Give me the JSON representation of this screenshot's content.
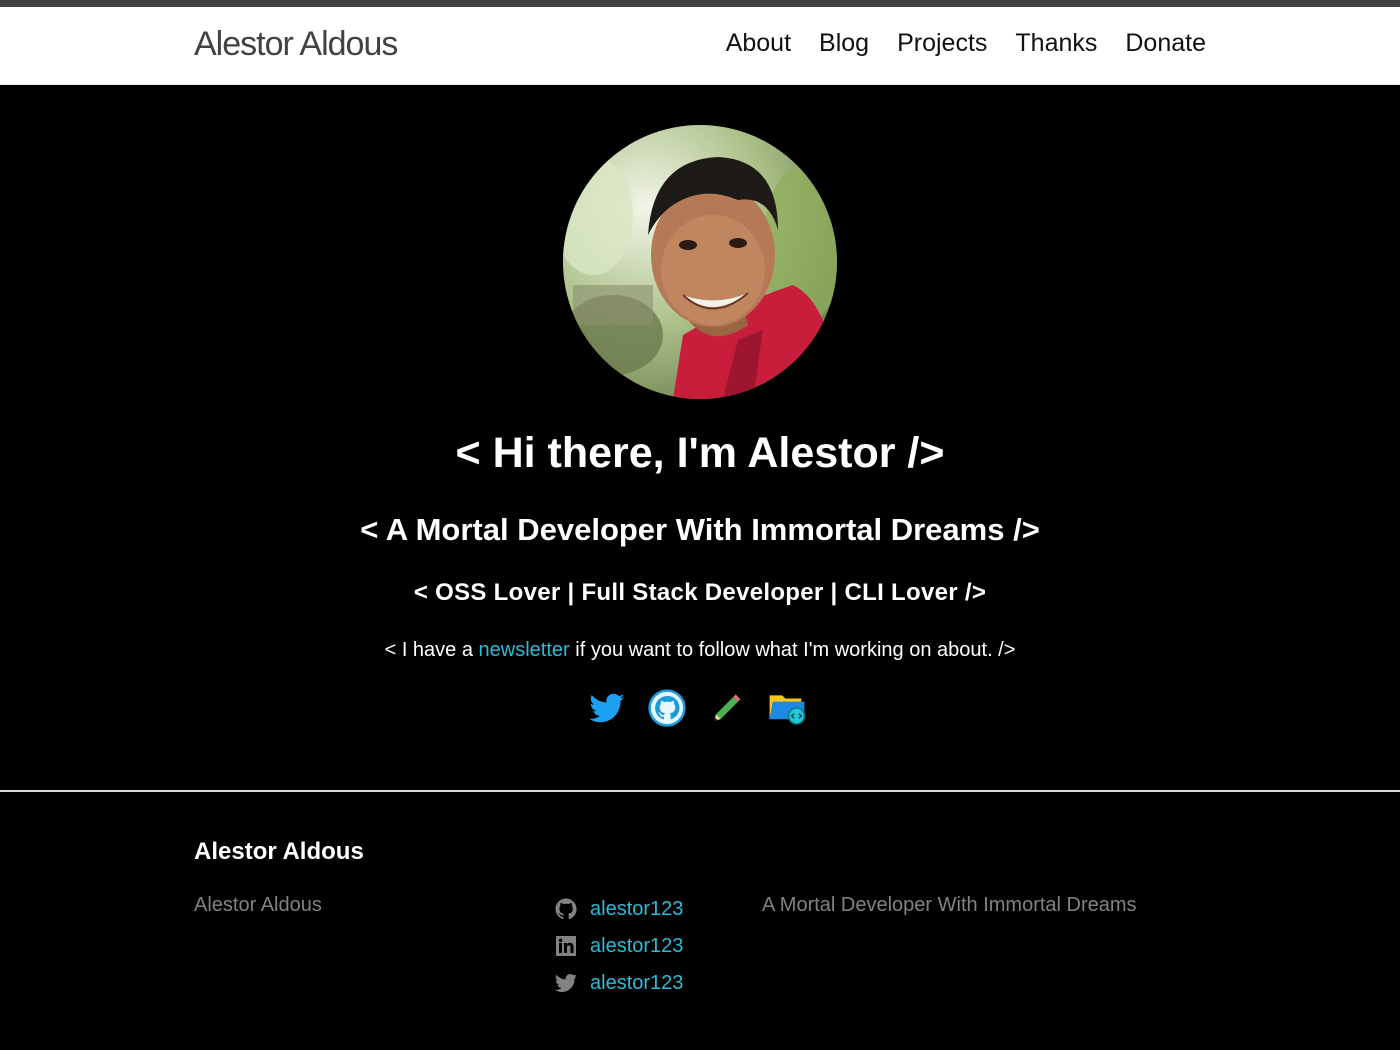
{
  "header": {
    "site_title": "Alestor Aldous",
    "nav": [
      {
        "label": "About"
      },
      {
        "label": "Blog"
      },
      {
        "label": "Projects"
      },
      {
        "label": "Thanks"
      },
      {
        "label": "Donate"
      }
    ]
  },
  "hero": {
    "title": "< Hi there, I'm Alestor />",
    "subtitle": "< A Mortal Developer With Immortal Dreams />",
    "tagline": "< OSS Lover | Full Stack Developer | CLI Lover />",
    "newsletter_prefix": "< I have a ",
    "newsletter_link": "newsletter",
    "newsletter_suffix": " if you want to follow what I'm working on about. />",
    "social_icons": [
      "twitter-icon",
      "github-icon",
      "pencil-icon",
      "folder-code-icon"
    ]
  },
  "footer": {
    "heading": "Alestor Aldous",
    "name": "Alestor Aldous",
    "links": [
      {
        "icon": "github-icon",
        "label": "alestor123"
      },
      {
        "icon": "linkedin-icon",
        "label": "alestor123"
      },
      {
        "icon": "twitter-icon",
        "label": "alestor123"
      }
    ],
    "description": "A Mortal Developer With Immortal Dreams"
  },
  "colors": {
    "accent": "#2bbbd8",
    "background": "#000000",
    "header_bg": "#ffffff",
    "muted_text": "#828282"
  }
}
